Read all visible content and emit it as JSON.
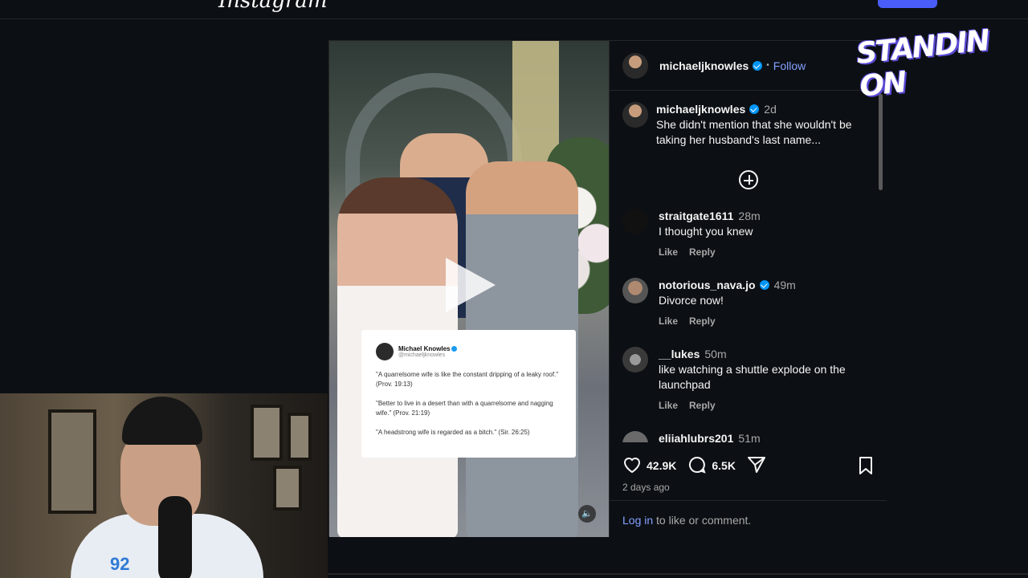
{
  "header": {
    "brand": "Instagram"
  },
  "post": {
    "author": "michaeljknowles",
    "follow_label": "Follow",
    "separator": "•",
    "caption_time": "2d",
    "caption": "She didn't mention that she wouldn't be taking her husband's last name...",
    "tweet": {
      "name": "Michael Knowles",
      "handle": "@michaeljknowles",
      "lines": [
        "\"A quarrelsome wife is like the constant dripping of a leaky roof.\" (Prov. 19:13)",
        "\"Better to live in a desert than with a quarrelsome and nagging wife.\" (Prov. 21:19)",
        "\"A headstrong wife is regarded as a bitch.\" (Sir. 26:25)"
      ]
    },
    "comments": [
      {
        "user": "straitgate1611",
        "time": "28m",
        "text": "I thought you knew",
        "verified": false
      },
      {
        "user": "notorious_nava.jo",
        "time": "49m",
        "text": "Divorce now!",
        "verified": true
      },
      {
        "user": "__lukes",
        "time": "50m",
        "text": "like watching a shuttle explode on the launchpad",
        "verified": false
      },
      {
        "user": "elijahlubrs201",
        "time": "51m",
        "text": "",
        "verified": false
      }
    ],
    "like_label": "Like",
    "reply_label": "Reply",
    "likes": "42.9K",
    "comment_count": "6.5K",
    "date": "2 days ago",
    "login_link": "Log in",
    "login_rest": " to like or comment."
  },
  "overlay": {
    "text": "STANDIN ON"
  },
  "webcam": {
    "shirt_logo": "92"
  },
  "colors": {
    "accent": "#0095f6",
    "link": "#85a1ff",
    "background": "#0c1014"
  }
}
